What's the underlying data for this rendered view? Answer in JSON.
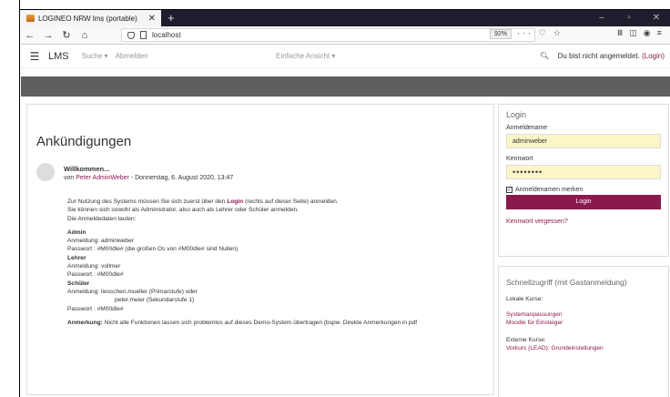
{
  "browser": {
    "tab_title": "LOGINEO NRW lms (portable)",
    "url": "localhost",
    "zoom": "92%"
  },
  "lms": {
    "brand": "LMS",
    "search": "Suche",
    "logout": "Abmelden",
    "view": "Einfache Ansicht",
    "status": "Du bist nicht angemeldet.",
    "login_link": "(Login)"
  },
  "main": {
    "title": "Ankündigungen",
    "post": {
      "subject": "Willkommen...",
      "by_prefix": "von",
      "author": "Peter AdminWeber",
      "date": "- Donnerstag, 6. August 2020, 13:47",
      "line1_a": "Zur Nutzung des Systems müssen Sie sich zuerst über den",
      "line1_link": "Login",
      "line1_b": "(rechts auf dieser Seite) anmelden.",
      "line2": "Sie können sich sowohl als Administrator, also auch als Lehrer oder Schüler anmelden.",
      "line3": "Die Anmeldedaten lauten:",
      "admin_h": "Admin",
      "admin_user": "Anmeldung: adminweber",
      "admin_pw": "Passwort   : #M00dle# (die großen Os von #M00dle# sind Nullen)",
      "teacher_h": "Lehrer",
      "teacher_user": "Anmeldung: vollmer",
      "teacher_pw": "Passwort   : #M00dle#",
      "student_h": "Schüler",
      "student_user": "Anmeldung: liesschen.mueller (Primarstufe) oder",
      "student_user2": "peter.meier (Sekundarstufe 1)",
      "student_pw": "Passwort   : #M00dle#",
      "note_label": "Anmerkung:",
      "note_text": "Nicht alle Funktionen lassen sich problemlos auf dieses Demo-System übertragen (bspw. Direkte Anmerkungen in pdf"
    }
  },
  "login": {
    "title": "Login",
    "user_label": "Anmeldename",
    "user_value": "adminweber",
    "pw_label": "Kennwort",
    "pw_value": "••••••••",
    "remember": "Anmeldenamen merken",
    "button": "Login",
    "forgot": "Kennwort vergessen?"
  },
  "quick": {
    "title": "Schnellzugriff (mit Gastanmeldung)",
    "local_label": "Lokale Kurse:",
    "local_1": "Systemanpassungen",
    "local_2": "Moodle für Einsteiger",
    "ext_label": "Externe Kurse:",
    "ext_1": "Vorkurs (LEAD): Grundeinstellungen"
  }
}
